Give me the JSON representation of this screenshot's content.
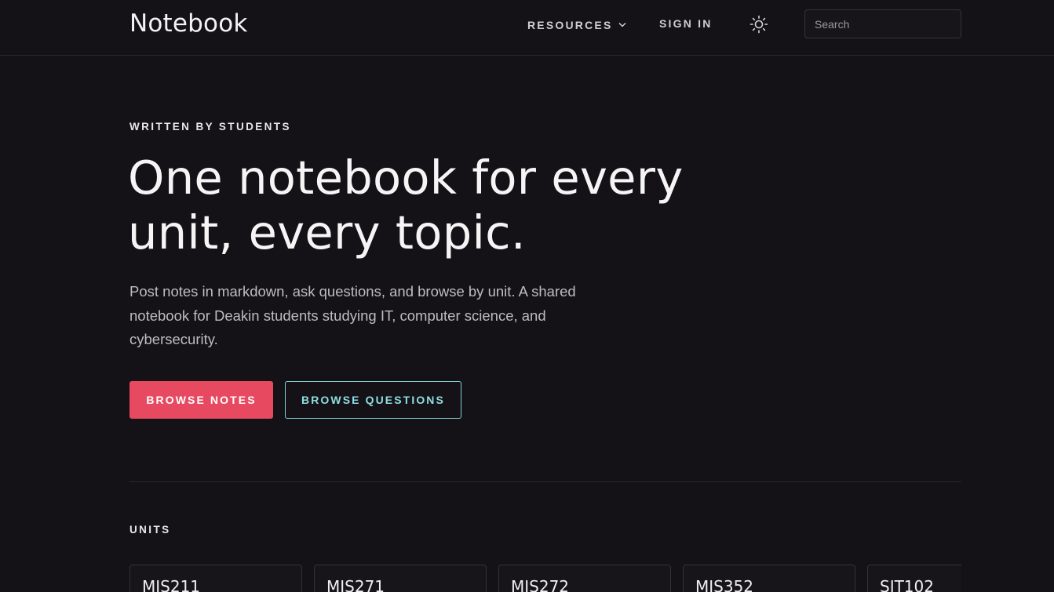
{
  "header": {
    "brand": "Notebook",
    "nav": {
      "resources_label": "RESOURCES",
      "signin_label": "SIGN IN"
    },
    "theme_toggle_icon": "sun-icon",
    "search": {
      "placeholder": "Search",
      "value": ""
    }
  },
  "hero": {
    "eyebrow": "WRITTEN BY STUDENTS",
    "headline_line1": "One notebook for every",
    "headline_line2": "unit, every topic.",
    "lead": "Post notes in markdown, ask questions, and browse by unit. A shared notebook for Deakin students studying IT, computer science, and cybersecurity.",
    "primary_button": "BROWSE NOTES",
    "secondary_button": "BROWSE QUESTIONS"
  },
  "units": {
    "label": "UNITS",
    "items": [
      {
        "code": "MIS211"
      },
      {
        "code": "MIS271"
      },
      {
        "code": "MIS272"
      },
      {
        "code": "MIS352"
      },
      {
        "code": "SIT102"
      }
    ]
  },
  "colors": {
    "background": "#141216",
    "accent_primary": "#e74a60",
    "accent_secondary": "#8fdfe3"
  }
}
